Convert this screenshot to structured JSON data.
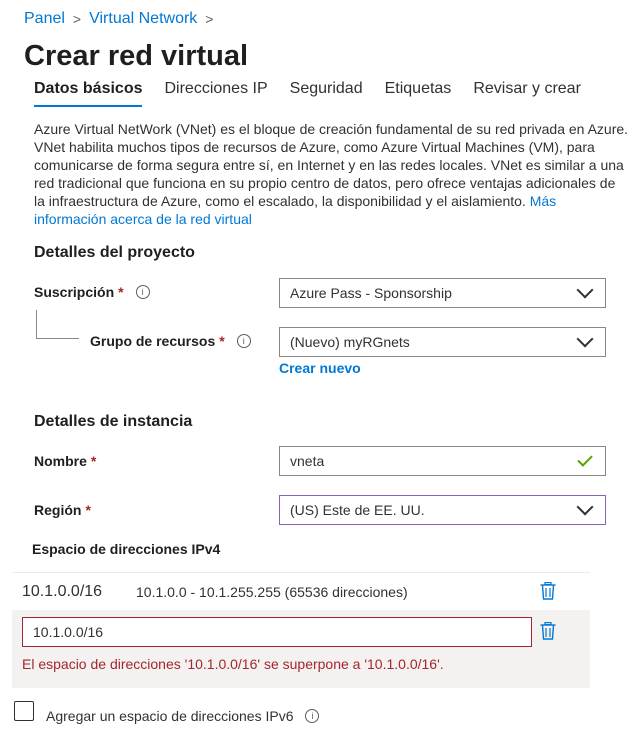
{
  "breadcrumb": {
    "items": [
      "Panel",
      "Virtual Network"
    ],
    "separator": ">"
  },
  "page": {
    "title": "Crear red virtual"
  },
  "tabs": [
    {
      "label": "Datos básicos",
      "active": true
    },
    {
      "label": "Direcciones IP",
      "active": false
    },
    {
      "label": "Seguridad",
      "active": false
    },
    {
      "label": "Etiquetas",
      "active": false
    },
    {
      "label": "Revisar y crear",
      "active": false
    }
  ],
  "description": {
    "text": "Azure Virtual NetWork (VNet) es el bloque de creación fundamental de su red privada en Azure. VNet habilita muchos tipos de recursos de Azure, como Azure Virtual Machines (VM), para comunicarse de forma segura entre sí, en Internet y en las redes locales. VNet es similar a una red tradicional que funciona en su propio centro de datos, pero ofrece ventajas adicionales de la infraestructura de Azure, como el escalado, la disponibilidad y el aislamiento.",
    "link": "Más información acerca de la red virtual"
  },
  "project": {
    "heading": "Detalles del proyecto",
    "subscription": {
      "label": "Suscripción",
      "required": "*",
      "value": "Azure Pass - Sponsorship"
    },
    "resource_group": {
      "label": "Grupo de recursos",
      "required": "*",
      "value": "(Nuevo) myRGnets",
      "create_link": "Crear nuevo"
    }
  },
  "instance": {
    "heading": "Detalles de instancia",
    "name": {
      "label": "Nombre",
      "required": "*",
      "value": "vneta"
    },
    "region": {
      "label": "Región",
      "required": "*",
      "value": "(US) Este de EE. UU."
    }
  },
  "ipv4": {
    "heading": "Espacio de direcciones IPv4",
    "rows": [
      {
        "cidr": "10.1.0.0/16",
        "range": "10.1.0.0 - 10.1.255.255 (65536 direcciones)"
      }
    ],
    "new_input_value": "10.1.0.0/16",
    "error": "El espacio de direcciones '10.1.0.0/16' se superpone a '10.1.0.0/16'."
  },
  "ipv6": {
    "checkbox_label": "Agregar un espacio de direcciones IPv6",
    "checked": false
  },
  "icons": {
    "info": "info-icon",
    "chevron": "chevron-down-icon",
    "check": "checkmark-icon",
    "trash": "trash-icon"
  },
  "colors": {
    "accent": "#0078d4",
    "error": "#a4262c",
    "success": "#57a300",
    "region_border": "#8764b8"
  }
}
